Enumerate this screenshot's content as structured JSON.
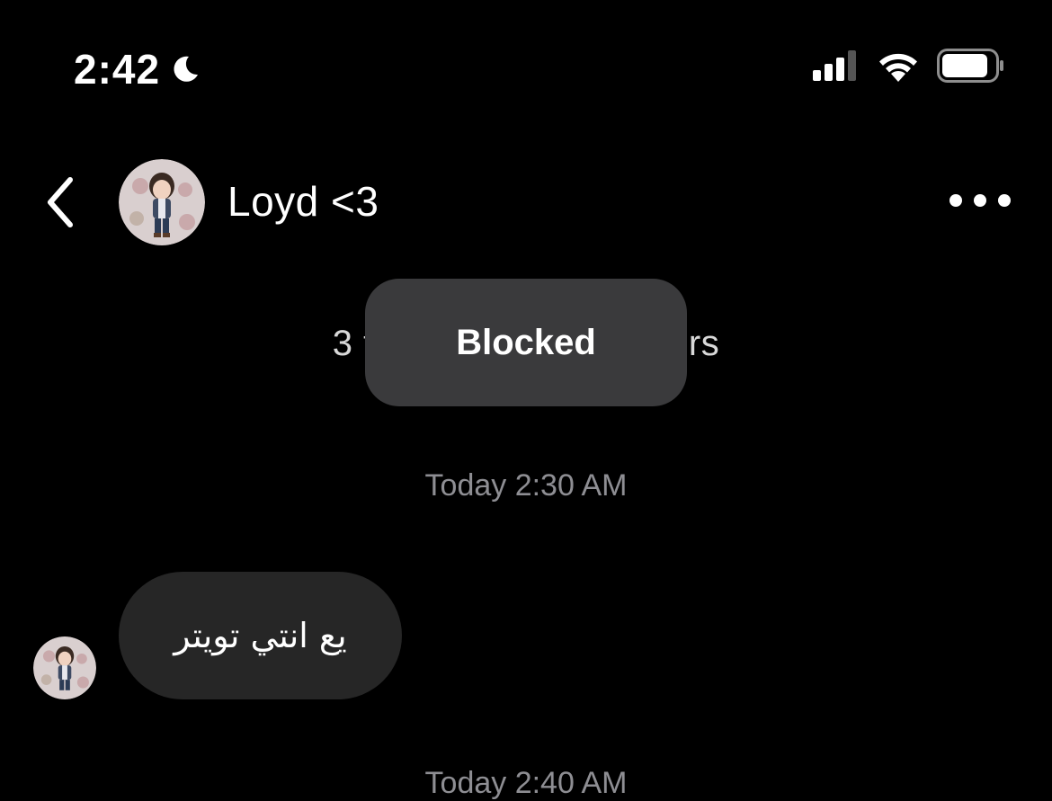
{
  "status_bar": {
    "time": "2:42",
    "focus_icon": "moon-icon",
    "signal_icon": "cellular-signal-icon",
    "wifi_icon": "wifi-icon",
    "battery_icon": "battery-icon"
  },
  "header": {
    "back_icon": "chevron-left-icon",
    "contact_name": "Loyd <3",
    "more_icon": "more-horizontal-icon"
  },
  "profile": {
    "info_line": "3 followers · 3 followers"
  },
  "toast": {
    "label": "Blocked"
  },
  "messages": [
    {
      "timestamp": "Today 2:30 AM",
      "text": "يع انتي تويتر"
    }
  ],
  "next_timestamp": "Today 2:40 AM",
  "colors": {
    "background": "#000000",
    "toast_bg": "#3a3a3c",
    "bubble_bg": "#262626",
    "timestamp": "#8e8e93"
  }
}
